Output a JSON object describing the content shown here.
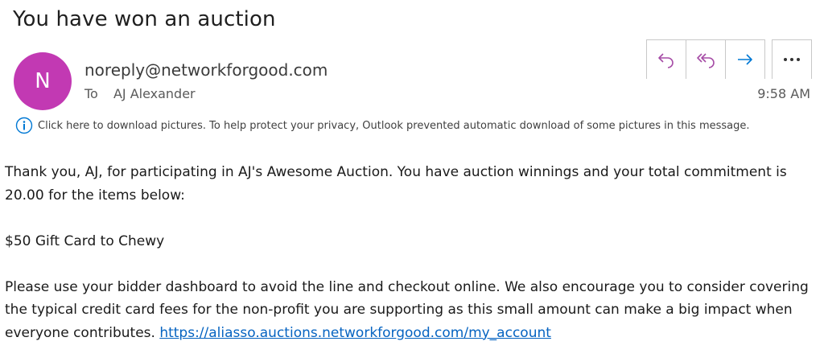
{
  "email": {
    "subject": "You have won an auction",
    "avatar_initial": "N",
    "avatar_color": "#c239b3",
    "sender": "noreply@networkforgood.com",
    "to_label": "To",
    "to_name": "AJ Alexander",
    "time": "9:58 AM",
    "info_message": "Click here to download pictures. To help protect your privacy, Outlook prevented automatic download of some pictures in this message.",
    "actions": {
      "reply_icon": "reply-icon",
      "reply_all_icon": "reply-all-icon",
      "forward_icon": "forward-icon",
      "more_icon": "more-icon"
    },
    "accent_color": "#0078d4"
  },
  "body": {
    "paragraph1": "Thank you, AJ, for participating in AJ's Awesome Auction. You have auction winnings and your total commitment is 20.00 for the items below:",
    "item": "$50 Gift Card to Chewy",
    "paragraph3": "Please use your bidder dashboard to avoid the line and checkout online. We also encourage you to consider covering the typical credit card fees for the non-profit you are supporting as this small amount can make a big impact when everyone contributes.",
    "link": "https://aliasso.auctions.networkforgood.com/my_account"
  }
}
